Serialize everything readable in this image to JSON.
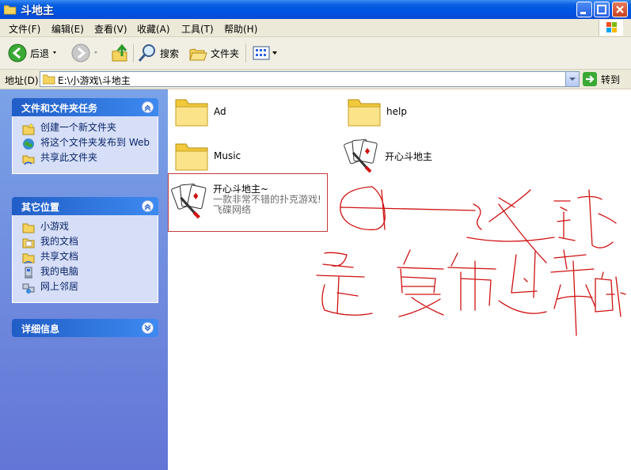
{
  "window": {
    "title": "斗地主"
  },
  "menu": [
    "文件(F)",
    "编辑(E)",
    "查看(V)",
    "收藏(A)",
    "工具(T)",
    "帮助(H)"
  ],
  "toolbar": {
    "back": "后退",
    "search": "搜索",
    "folders": "文件夹"
  },
  "address": {
    "label": "地址(D)",
    "path": "E:\\小游戏\\斗地主",
    "go": "转到"
  },
  "tasks_panel": {
    "title": "文件和文件夹任务",
    "items": [
      "创建一个新文件夹",
      "将这个文件夹发布到 Web",
      "共享此文件夹"
    ]
  },
  "places_panel": {
    "title": "其它位置",
    "items": [
      "小游戏",
      "我的文档",
      "共享文档",
      "我的电脑",
      "网上邻居"
    ]
  },
  "details_panel": {
    "title": "详细信息"
  },
  "files": [
    {
      "name": "Ad",
      "kind": "folder"
    },
    {
      "name": "help",
      "kind": "folder"
    },
    {
      "name": "Music",
      "kind": "folder"
    },
    {
      "name": "开心斗地主",
      "kind": "game"
    }
  ],
  "tile": {
    "title": "开心斗地主~",
    "line2": "一款非常不错的扑克游戏!",
    "line3": "飞碟网络"
  },
  "colors": {
    "titlebar": "#0054e3",
    "panel": "#6f8fe0",
    "annotation": "#d01010"
  }
}
